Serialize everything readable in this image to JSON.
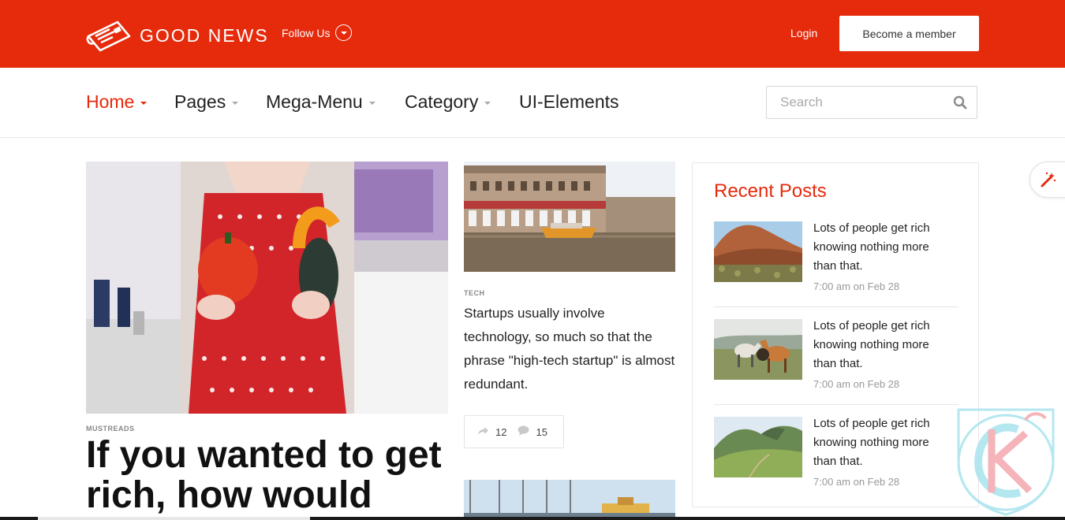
{
  "brand": {
    "name": "GOOD NEWS",
    "accent": "#e62a0c"
  },
  "topbar": {
    "follow_label": "Follow Us",
    "login_label": "Login",
    "member_label": "Become a member"
  },
  "nav": {
    "items": [
      {
        "label": "Home",
        "active": true,
        "dropdown": true
      },
      {
        "label": "Pages",
        "active": false,
        "dropdown": true
      },
      {
        "label": "Mega-Menu",
        "active": false,
        "dropdown": true
      },
      {
        "label": "Category",
        "active": false,
        "dropdown": true
      },
      {
        "label": "UI-Elements",
        "active": false,
        "dropdown": false
      }
    ],
    "search_placeholder": "Search"
  },
  "feature": {
    "category": "MUSTREADS",
    "headline": "If you wanted to get rich, how would"
  },
  "middle": {
    "category": "TECH",
    "text": "Startups usually involve technology, so much so that the phrase \"high-tech startup\" is almost redundant.",
    "shares": "12",
    "comments": "15"
  },
  "sidebar": {
    "title": "Recent Posts",
    "posts": [
      {
        "title": "Lots of people get rich knowing nothing more than that.",
        "date": "7:00 am on Feb 28"
      },
      {
        "title": "Lots of people get rich knowing nothing more than that.",
        "date": "7:00 am on Feb 28"
      },
      {
        "title": "Lots of people get rich knowing nothing more than that.",
        "date": "7:00 am on Feb 28"
      }
    ]
  },
  "icons": [
    "newspaper-icon",
    "chevron-down-icon",
    "search-icon",
    "share-icon",
    "comment-icon",
    "magic-wand-icon"
  ]
}
